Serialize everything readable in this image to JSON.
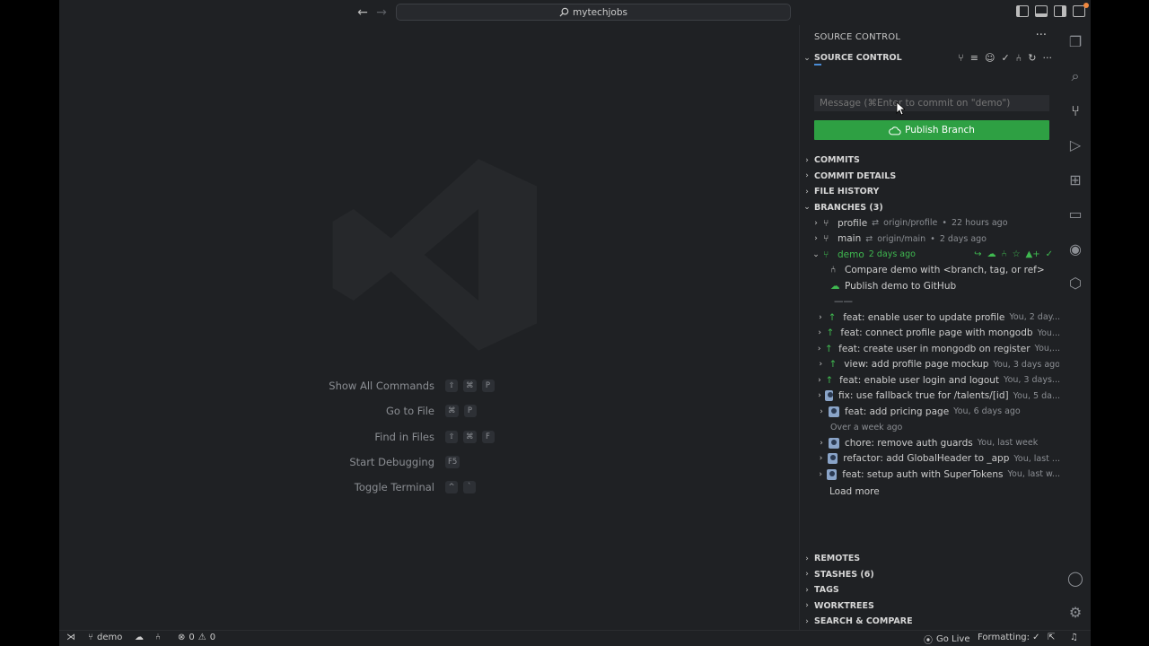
{
  "titlebar": {
    "back_arrow": "←",
    "forward_arrow": "→",
    "search_text": "mytechjobs"
  },
  "welcome": {
    "shortcuts": [
      {
        "label": "Show All Commands",
        "keys": [
          "⇧",
          "⌘",
          "P"
        ]
      },
      {
        "label": "Go to File",
        "keys": [
          "⌘",
          "P"
        ]
      },
      {
        "label": "Find in Files",
        "keys": [
          "⇧",
          "⌘",
          "F"
        ]
      },
      {
        "label": "Start Debugging",
        "keys": [
          "F5"
        ]
      },
      {
        "label": "Toggle Terminal",
        "keys": [
          "^",
          "`"
        ]
      }
    ]
  },
  "sidebar": {
    "title": "SOURCE CONTROL",
    "more": "···",
    "source_control_section": "SOURCE CONTROL",
    "commit_placeholder": "Message (⌘Enter to commit on \"demo\")",
    "publish_label": "Publish Branch",
    "sections_top": [
      "COMMITS",
      "COMMIT DETAILS",
      "FILE HISTORY"
    ],
    "branches_section": "BRANCHES (3)",
    "branches": [
      {
        "name": "profile",
        "remote": "origin/profile",
        "time": "22 hours ago"
      },
      {
        "name": "main",
        "remote": "origin/main",
        "time": "2 days ago"
      },
      {
        "name": "demo",
        "time": "2 days ago"
      }
    ],
    "demo_actions": [
      {
        "text": "Compare demo with <branch, tag, or ref>"
      },
      {
        "text": "Publish demo to GitHub"
      }
    ],
    "divider": "——",
    "commits": [
      {
        "message": "feat: enable user to update profile",
        "meta": "You, 2 day...",
        "kind": "up"
      },
      {
        "message": "feat: connect profile page with mongodb",
        "meta": "You...",
        "kind": "up"
      },
      {
        "message": "feat: create user in mongodb on register",
        "meta": "You,...",
        "kind": "up"
      },
      {
        "message": "view: add profile page mockup",
        "meta": "You, 3 days ago",
        "kind": "up"
      },
      {
        "message": "feat: enable user login and logout",
        "meta": "You, 3 days...",
        "kind": "up"
      },
      {
        "message": "fix: use fallback true for /talents/[id]",
        "meta": "You, 5 da...",
        "kind": "avatar"
      },
      {
        "message": "feat: add pricing page",
        "meta": "You, 6 days ago",
        "kind": "avatar"
      }
    ],
    "older_group": "Over a week ago",
    "older_commits": [
      {
        "message": "chore: remove auth guards",
        "meta": "You, last week"
      },
      {
        "message": "refactor: add GlobalHeader to _app",
        "meta": "You, last ..."
      },
      {
        "message": "feat: setup auth with SuperTokens",
        "meta": "You, last w..."
      }
    ],
    "load_more": "Load more",
    "sections_bottom": [
      "REMOTES",
      "STASHES (6)",
      "TAGS",
      "WORKTREES",
      "SEARCH & COMPARE"
    ]
  },
  "statusbar": {
    "branch": "demo",
    "errors": "0",
    "warnings": "0",
    "go_live": "Go Live",
    "formatting": "Formatting: ✓"
  },
  "colors": {
    "accent_green": "#2ea043",
    "branch_green": "#3fb950",
    "background": "#1f2124"
  }
}
